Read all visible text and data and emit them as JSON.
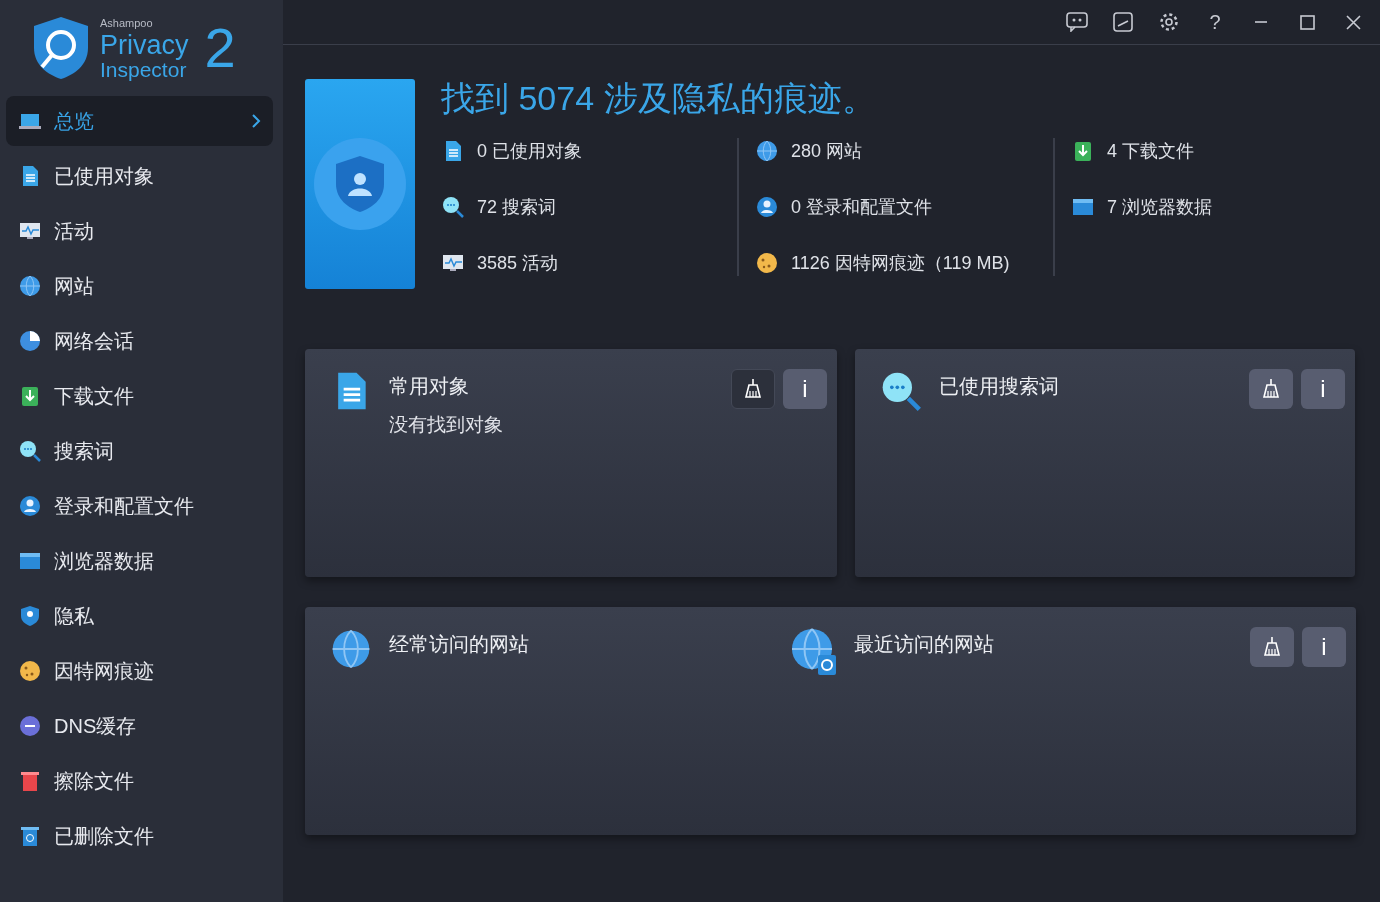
{
  "brand": {
    "company": "Ashampoo",
    "line1": "Privacy",
    "line2": "Inspector",
    "version": "2"
  },
  "window_controls": [
    "?"
  ],
  "sidebar": {
    "items": [
      {
        "label": "总览",
        "kind": "laptop",
        "selected": true
      },
      {
        "label": "已使用对象",
        "kind": "doc",
        "selected": false
      },
      {
        "label": "活动",
        "kind": "monitor",
        "selected": false
      },
      {
        "label": "网站",
        "kind": "globe",
        "selected": false
      },
      {
        "label": "网络会话",
        "kind": "pie",
        "selected": false
      },
      {
        "label": "下载文件",
        "kind": "download",
        "selected": false
      },
      {
        "label": "搜索词",
        "kind": "search",
        "selected": false
      },
      {
        "label": "登录和配置文件",
        "kind": "user",
        "selected": false
      },
      {
        "label": "浏览器数据",
        "kind": "browser",
        "selected": false
      },
      {
        "label": "隐私",
        "kind": "shield",
        "selected": false
      },
      {
        "label": "因特网痕迹",
        "kind": "cookie",
        "selected": false
      },
      {
        "label": "DNS缓存",
        "kind": "dns",
        "selected": false
      },
      {
        "label": "擦除文件",
        "kind": "trash",
        "selected": false
      },
      {
        "label": "已删除文件",
        "kind": "recycle",
        "selected": false
      }
    ]
  },
  "summary": {
    "headline": "找到 5074 涉及隐私的痕迹。",
    "columns": [
      [
        {
          "text": "0 已使用对象",
          "kind": "doc"
        },
        {
          "text": "72 搜索词",
          "kind": "search"
        },
        {
          "text": "3585 活动",
          "kind": "monitor"
        }
      ],
      [
        {
          "text": "280 网站",
          "kind": "globe"
        },
        {
          "text": "0 登录和配置文件",
          "kind": "user"
        },
        {
          "text": "1126 因特网痕迹（119 MB)",
          "kind": "cookie"
        }
      ],
      [
        {
          "text": "4 下载文件",
          "kind": "download"
        },
        {
          "text": "7 浏览器数据",
          "kind": "browser"
        }
      ]
    ]
  },
  "cards": [
    {
      "sections": [
        {
          "title": "常用对象",
          "subtitle": "没有找到对象",
          "kind": "doc"
        }
      ],
      "clean_disabled": true,
      "info": "i"
    },
    {
      "sections": [
        {
          "title": "已使用搜索词",
          "kind": "search"
        }
      ],
      "clean_disabled": false,
      "info": "i"
    },
    {
      "sections": [
        {
          "title": "经常访问的网站",
          "kind": "globe"
        },
        {
          "title": "最近访问的网站",
          "kind": "globe-clock"
        }
      ],
      "clean_disabled": false,
      "info": "i"
    }
  ]
}
